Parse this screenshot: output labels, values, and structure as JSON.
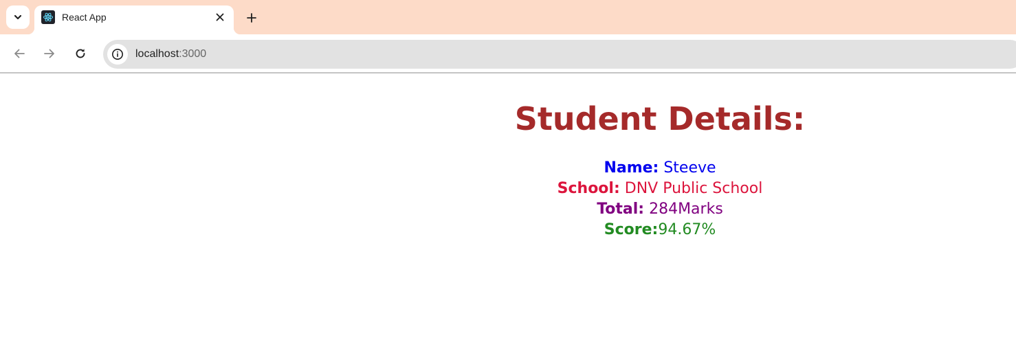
{
  "browser": {
    "tab_title": "React App",
    "url_host": "localhost",
    "url_port": ":3000",
    "tab_bar_color": "#fddbc8",
    "icons": {
      "tab_search": "chevron-down-icon",
      "favicon": "react-logo-icon",
      "close": "close-icon",
      "new_tab": "plus-icon",
      "back": "arrow-left-icon",
      "forward": "arrow-right-icon",
      "reload": "reload-icon",
      "site_info": "info-icon"
    }
  },
  "page": {
    "heading": "Student Details:",
    "heading_color": "#a52a2a",
    "rows": [
      {
        "label": "Name:",
        "value": " Steeve",
        "color": "#0000ee"
      },
      {
        "label": "School:",
        "value": " DNV Public School",
        "color": "#dc143c"
      },
      {
        "label": "Total:",
        "value": " 284Marks",
        "color": "#800080"
      },
      {
        "label": "Score:",
        "value": "94.67%",
        "color": "#228b22"
      }
    ]
  }
}
